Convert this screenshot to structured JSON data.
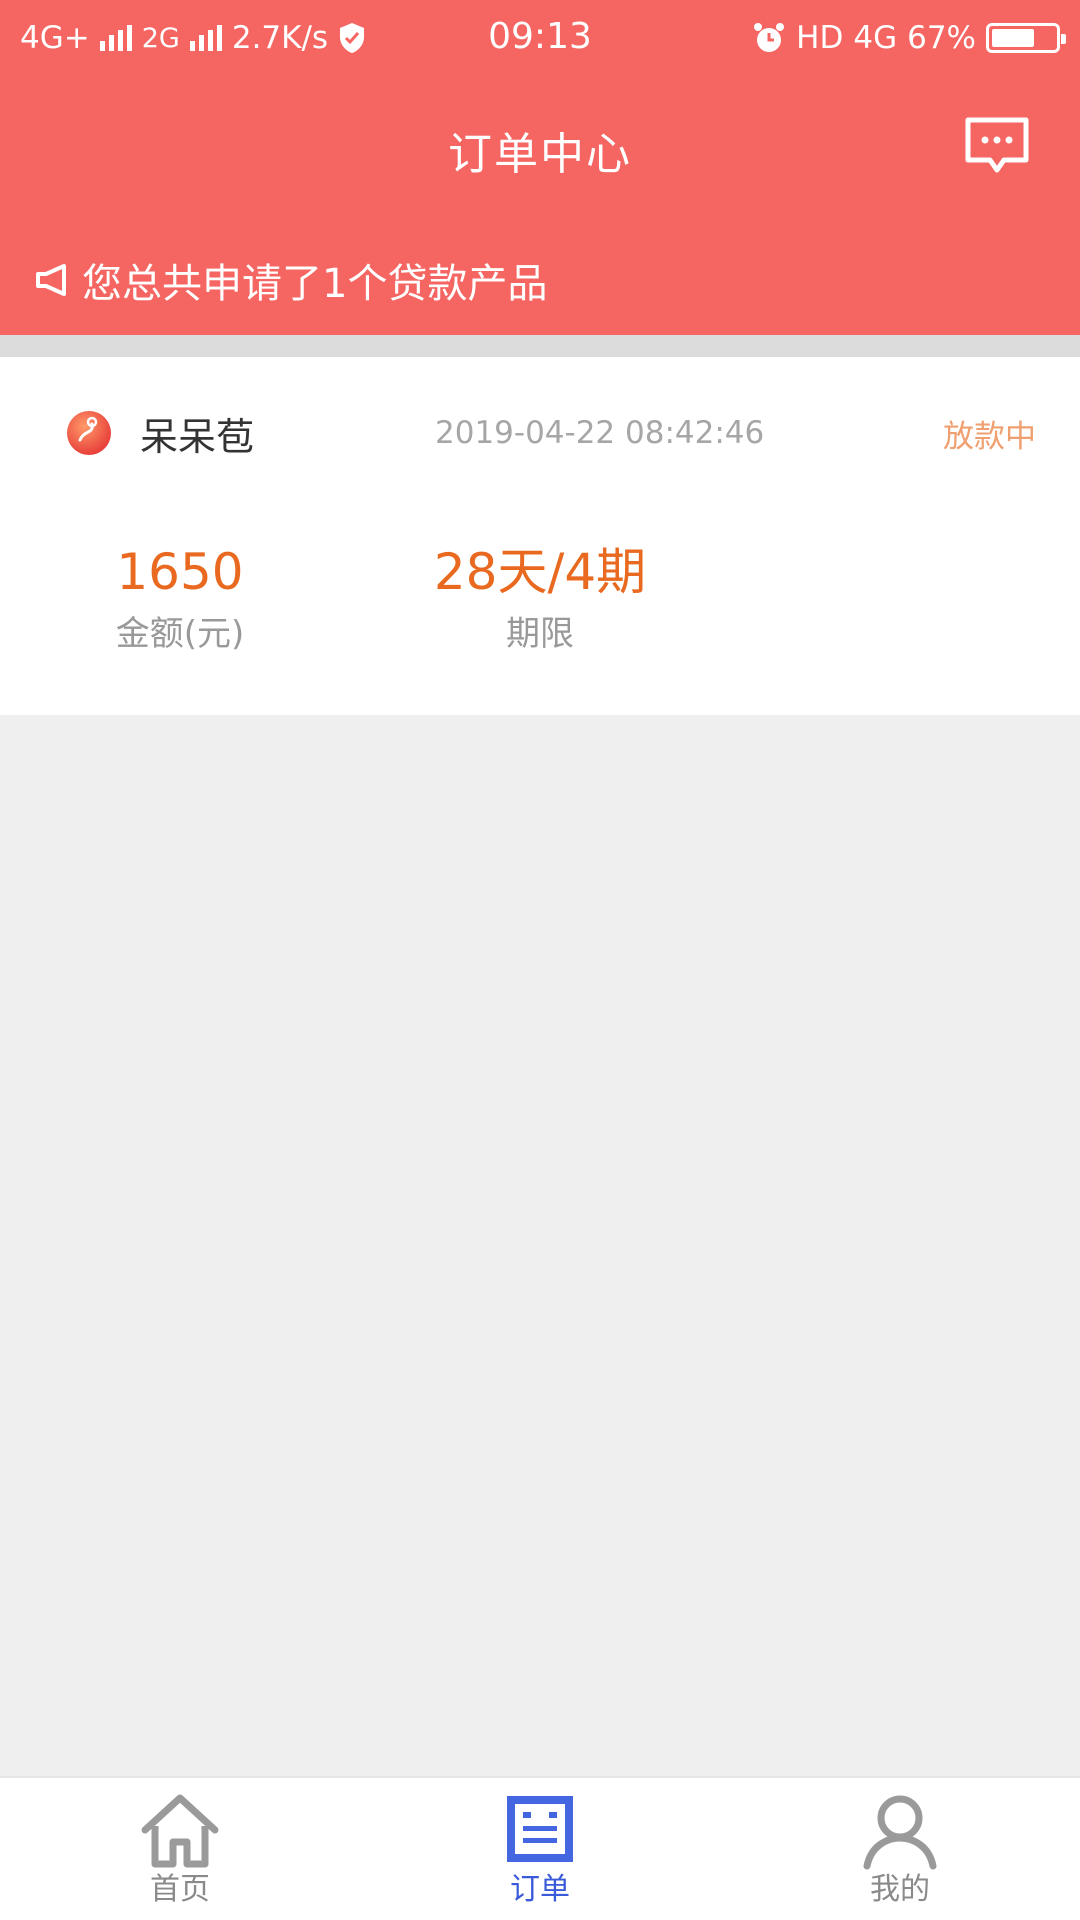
{
  "status_bar": {
    "network1": "4G+",
    "network2": "2G",
    "speed": "2.7K/s",
    "time": "09:13",
    "hd": "HD",
    "network3": "4G",
    "battery": "67%",
    "battery_level": 0.67
  },
  "header": {
    "title": "订单中心",
    "notice": "您总共申请了1个贷款产品",
    "background_color": "#f56662"
  },
  "order": {
    "product_name": "呆呆苞",
    "time": "2019-04-22 08:42:46",
    "status": "放款中",
    "amount_value": "1650",
    "amount_label": "金额(元)",
    "term_value": "28天/4期",
    "term_label": "期限"
  },
  "tabbar": {
    "items": [
      {
        "label": "首页",
        "icon": "home-icon",
        "active": false
      },
      {
        "label": "订单",
        "icon": "order-icon",
        "active": true
      },
      {
        "label": "我的",
        "icon": "profile-icon",
        "active": false
      }
    ],
    "active_color": "#3a5ad9"
  }
}
